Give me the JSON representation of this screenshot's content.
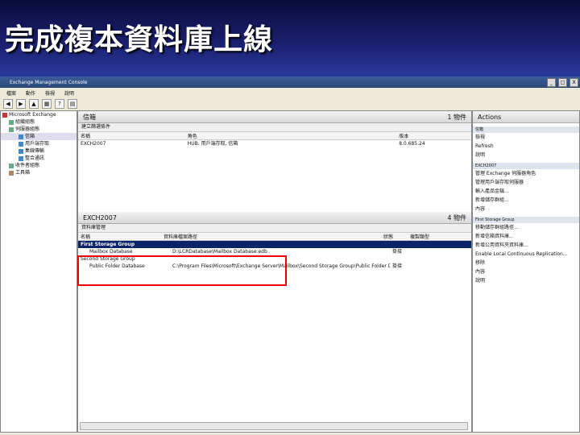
{
  "slide": {
    "title": "完成複本資料庫上線"
  },
  "window": {
    "title": "Exchange Management Console",
    "controls": [
      "_",
      "□",
      "X"
    ]
  },
  "menu": [
    "檔案",
    "動作",
    "檢視",
    "說明"
  ],
  "tree": [
    "Microsoft Exchange",
    "組織組態",
    "伺服器組態",
    "信箱",
    "用戶端存取",
    "集線傳輸",
    "整合通訊",
    "收件者組態",
    "工具箱"
  ],
  "top_pane": {
    "title": "信箱",
    "count": "1 物件",
    "filter_label": "建立篩選條件",
    "columns": [
      "名稱",
      "角色",
      "版本"
    ],
    "rows": [
      [
        "EXCH2007",
        "HUB, 用戶端存取, 信箱",
        "8.0.685.24"
      ]
    ]
  },
  "bottom_pane": {
    "title": "EXCH2007",
    "count": "4 物件",
    "tab": "資料庫管理",
    "columns": [
      "名稱",
      "資料庫檔案路徑",
      "狀態",
      "複製類型"
    ],
    "rows": [
      {
        "name": "First Storage Group",
        "path": "",
        "status": "",
        "type": "",
        "selected": true
      },
      {
        "name": "Mailbox Database",
        "path": "D:\\LCRDatabase\\Mailbox Database.edb",
        "status": "掛接",
        "type": "",
        "selected": false
      },
      {
        "name": "Second Storage Group",
        "path": "",
        "status": "",
        "type": "",
        "selected": false
      },
      {
        "name": "Public Folder Database",
        "path": "C:\\Program Files\\Microsoft\\Exchange Server\\Mailbox\\Second Storage Group\\Public Folder Database.edb",
        "status": "掛接",
        "type": "",
        "selected": false
      }
    ]
  },
  "actions": {
    "title": "Actions",
    "groups": [
      {
        "label": "信箱",
        "items": [
          "檢視",
          "Refresh",
          "說明"
        ]
      },
      {
        "label": "EXCH2007",
        "items": [
          "管理 Exchange 伺服器角色",
          "管理用戶端存取伺服器",
          "輸入產品金鑰...",
          "新增儲存群組...",
          "內容"
        ]
      },
      {
        "label": "First Storage Group",
        "items": [
          "移動儲存群組路徑...",
          "新增信箱資料庫...",
          "新增公用資料夾資料庫...",
          "Enable Local Continuous Replication...",
          "移除",
          "內容",
          "說明"
        ]
      }
    ]
  }
}
